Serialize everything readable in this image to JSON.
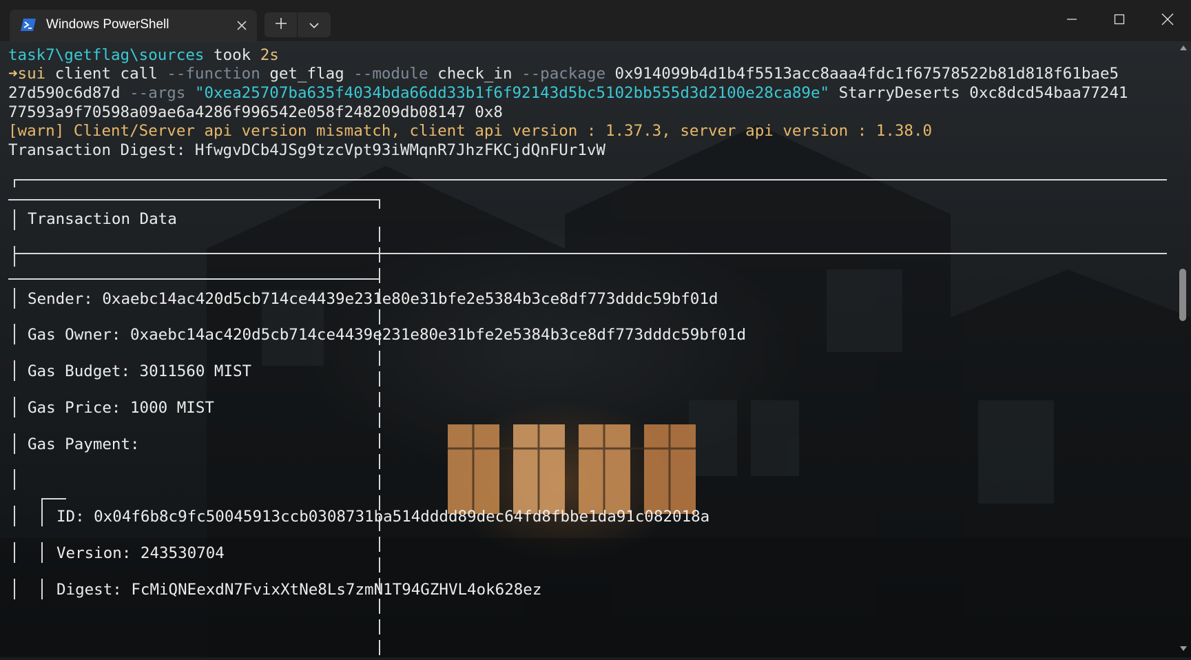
{
  "window": {
    "tab_title": "Windows PowerShell",
    "icons": [
      "powershell-icon",
      "close-icon",
      "plus-icon",
      "chevron-down-icon",
      "minimize-icon",
      "maximize-icon",
      "close-window-icon"
    ]
  },
  "terminal": {
    "prompt": {
      "path": "task7\\getflag\\sources",
      "took": "took",
      "duration": "2s"
    },
    "command": {
      "arrow": "➜",
      "sui": "sui",
      "client_call": "client call",
      "flag_function": "--function",
      "function_name": "get_flag",
      "flag_module": "--module",
      "module_name": "check_in",
      "flag_package": "--package",
      "package_id_1": "0x914099b4d1b4f5513acc8aaa4fdc1f67578522b81d818f61bae5",
      "package_id_2": "27d590c6d87d",
      "flag_args": "--args",
      "arg_quoted": "\"0xea25707ba635f4034bda66dd33b1f6f92143d5bc5102bb555d3d2100e28ca89e\"",
      "arg_name": "StarryDeserts",
      "arg_obj_1": "0xc8dcd54baa77241",
      "arg_obj_2": "77593a9f70598a09ae6a4286f996542e058f248209db08147 0x8"
    },
    "warning": "[warn] Client/Server api version mismatch, client api version : 1.37.3, server api version : 1.38.0",
    "digest_line": "Transaction Digest: HfwgvDCb4JSg9tzcVpt93iWMqnR7JhzFKCjdQnFUr1vW",
    "tx_data": {
      "header": "Transaction Data",
      "sender": "Sender: 0xaebc14ac420d5cb714ce4439e231e80e31bfe2e5384b3ce8df773dddc59bf01d",
      "gas_owner": "Gas Owner: 0xaebc14ac420d5cb714ce4439e231e80e31bfe2e5384b3ce8df773dddc59bf01d",
      "gas_budget": "Gas Budget: 3011560 MIST",
      "gas_price": "Gas Price: 1000 MIST",
      "gas_payment": "Gas Payment:",
      "payment_id": "ID: 0x04f6b8c9fc50045913ccb0308731ba514dddd89dec64fd8fbbe1da91c082018a",
      "payment_version": "Version: 243530704",
      "payment_digest": "Digest: FcMiQNEexdN7FvixXtNe8Ls7zmN1T94GZHVL4ok628ez"
    }
  },
  "colors": {
    "prompt_path": "#3bc9d4",
    "duration": "#e5c07b",
    "warning": "#e8b86a",
    "flags": "#7e8a96"
  }
}
